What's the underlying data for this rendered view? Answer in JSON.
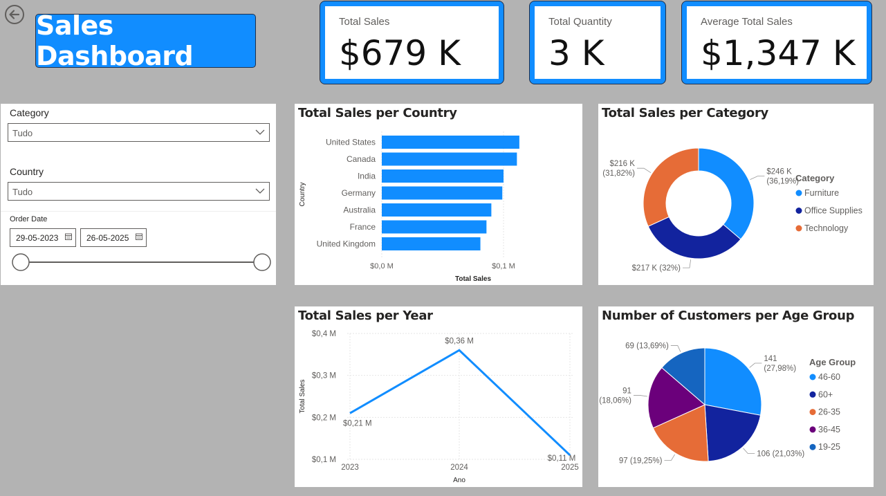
{
  "header": {
    "title": "Sales Dashboard"
  },
  "kpis": [
    {
      "label": "Total Sales",
      "value": "$679 K"
    },
    {
      "label": "Total Quantity",
      "value": "3 K"
    },
    {
      "label": "Average Total Sales",
      "value": "$1,347 K"
    }
  ],
  "slicers": {
    "category": {
      "label": "Category",
      "value": "Tudo"
    },
    "country": {
      "label": "Country",
      "value": "Tudo"
    },
    "order_date": {
      "label": "Order Date",
      "start": "29-05-2023",
      "end": "26-05-2025"
    }
  },
  "colors": {
    "accent": "#118dff",
    "navy": "#12239e",
    "orange": "#e66c37",
    "purple": "#6b007b",
    "mid_blue": "#1565c0",
    "background": "#b3b3b3"
  },
  "icons": {
    "back": "back-arrow-circle-icon",
    "dropdown": "chevron-down-icon",
    "calendar": "calendar-icon"
  },
  "chart_data": [
    {
      "id": "country",
      "type": "bar",
      "orientation": "horizontal",
      "title": "Total Sales per Country",
      "xlabel": "Total Sales",
      "ylabel": "Country",
      "categories": [
        "United States",
        "Canada",
        "India",
        "Germany",
        "Australia",
        "France",
        "United Kingdom"
      ],
      "values": [
        0.113,
        0.111,
        0.1,
        0.099,
        0.09,
        0.086,
        0.081
      ],
      "xlim": [
        0,
        0.13
      ],
      "x_ticks": [
        {
          "value": 0,
          "label": "$0,0 M"
        },
        {
          "value": 0.1,
          "label": "$0,1 M"
        }
      ],
      "grid": true
    },
    {
      "id": "category",
      "type": "pie",
      "donut": true,
      "title": "Total Sales per Category",
      "legend_title": "Category",
      "legend_position": "right",
      "slices": [
        {
          "name": "Furniture",
          "value": 246,
          "label": [
            "$246 K",
            "(36,19%)"
          ],
          "color": "#118dff"
        },
        {
          "name": "Office Supplies",
          "value": 217,
          "label": [
            "$217 K (32%)"
          ],
          "color": "#12239e"
        },
        {
          "name": "Technology",
          "value": 216,
          "label": [
            "$216 K",
            "(31,82%)"
          ],
          "color": "#e66c37"
        }
      ]
    },
    {
      "id": "year",
      "type": "line",
      "title": "Total Sales per Year",
      "xlabel": "Ano",
      "ylabel": "Total Sales",
      "x": [
        "2023",
        "2024",
        "2025"
      ],
      "series": [
        {
          "values": [
            0.21,
            0.36,
            0.11
          ],
          "labels": [
            "$0,21 M",
            "$0,36 M",
            "$0,11 M"
          ]
        }
      ],
      "ylim": [
        0.1,
        0.4
      ],
      "y_ticks": [
        {
          "value": 0.4,
          "label": "$0,4 M"
        },
        {
          "value": 0.3,
          "label": "$0,3 M"
        },
        {
          "value": 0.2,
          "label": "$0,2 M"
        },
        {
          "value": 0.1,
          "label": "$0,1 M"
        }
      ],
      "grid": true
    },
    {
      "id": "age",
      "type": "pie",
      "title": "Number of Customers per Age Group",
      "legend_title": "Age Group",
      "legend_position": "right",
      "slices": [
        {
          "name": "46-60",
          "value": 141,
          "label": [
            "141",
            "(27,98%)"
          ],
          "color": "#118dff"
        },
        {
          "name": "60+",
          "value": 106,
          "label": [
            "106 (21,03%)"
          ],
          "color": "#12239e"
        },
        {
          "name": "26-35",
          "value": 97,
          "label": [
            "97 (19,25%)"
          ],
          "color": "#e66c37"
        },
        {
          "name": "36-45",
          "value": 91,
          "label": [
            "91",
            "(18,06%)"
          ],
          "color": "#6b007b"
        },
        {
          "name": "19-25",
          "value": 69,
          "label": [
            "69 (13,69%)"
          ],
          "color": "#1565c0"
        }
      ]
    }
  ]
}
